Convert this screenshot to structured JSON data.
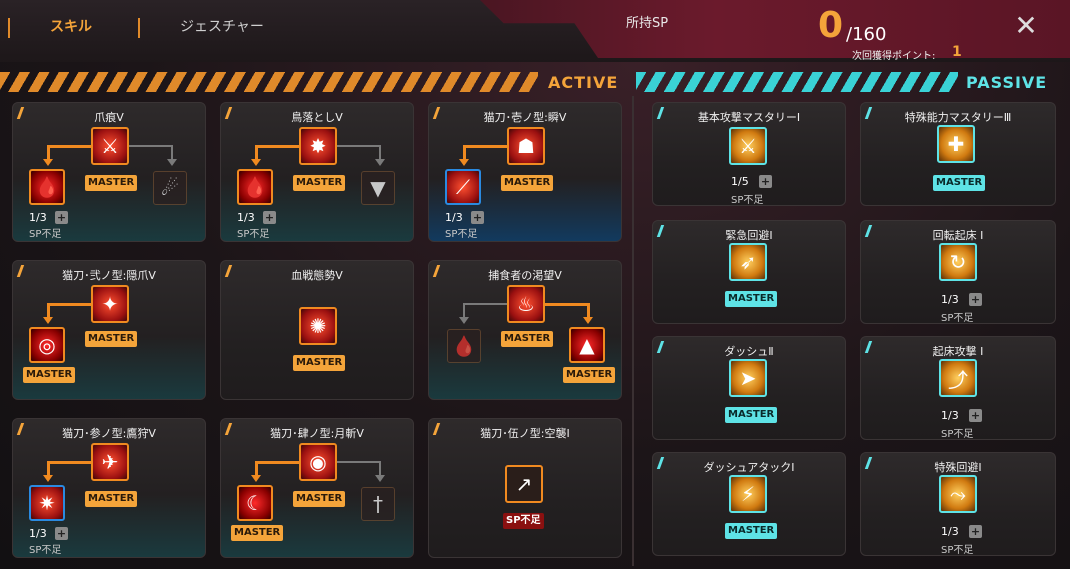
{
  "header": {
    "tab_skill": "スキル",
    "tab_gesture": "ジェスチャー",
    "sp_title": "所持SP",
    "sp_current": "0",
    "sp_max": "/160",
    "next_label": "次回獲得ポイント:",
    "next_value": "1",
    "close": "✕"
  },
  "sections": {
    "active": "ACTIVE",
    "passive": "PASSIVE"
  },
  "labels": {
    "master": "MASTER",
    "sp_short": "SP不足",
    "plus": "+"
  },
  "active": [
    {
      "title": "爪痕Ⅴ",
      "level": "1/3"
    },
    {
      "title": "鳥落としⅤ",
      "level": "1/3"
    },
    {
      "title": "猫刀･壱ノ型:瞬Ⅴ",
      "level": "1/3"
    },
    {
      "title": "猫刀･弐ノ型:隠爪Ⅴ"
    },
    {
      "title": "血戦態勢Ⅴ"
    },
    {
      "title": "捕食者の渇望Ⅴ"
    },
    {
      "title": "猫刀･参ノ型:鷹狩Ⅴ",
      "level": "1/3"
    },
    {
      "title": "猫刀･肆ノ型:月斬Ⅴ"
    },
    {
      "title": "猫刀･伍ノ型:空襲Ⅰ"
    }
  ],
  "passive": [
    {
      "title": "基本攻撃マスタリーⅠ",
      "level": "1/5"
    },
    {
      "title": "特殊能力マスタリーⅢ"
    },
    {
      "title": "緊急回避Ⅰ"
    },
    {
      "title": "回転起床 Ⅰ",
      "level": "1/3"
    },
    {
      "title": "ダッシュⅡ"
    },
    {
      "title": "起床攻撃 Ⅰ",
      "level": "1/3"
    },
    {
      "title": "ダッシュアタックⅠ"
    },
    {
      "title": "特殊回避Ⅰ",
      "level": "1/3"
    }
  ]
}
